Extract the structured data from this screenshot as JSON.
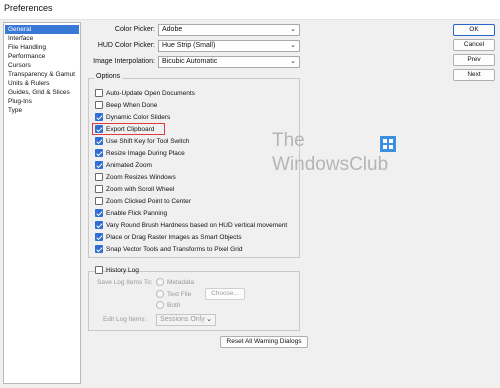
{
  "window": {
    "title": "Preferences"
  },
  "sidebar": {
    "items": [
      {
        "label": "General",
        "selected": true
      },
      {
        "label": "Interface"
      },
      {
        "label": "File Handling"
      },
      {
        "label": "Performance"
      },
      {
        "label": "Cursors"
      },
      {
        "label": "Transparency & Gamut"
      },
      {
        "label": "Units & Rulers"
      },
      {
        "label": "Guides, Grid & Slices"
      },
      {
        "label": "Plug-Ins"
      },
      {
        "label": "Type"
      }
    ]
  },
  "fields": {
    "color_picker": {
      "label": "Color Picker:",
      "value": "Adobe"
    },
    "hud_color_picker": {
      "label": "HUD Color Picker:",
      "value": "Hue Strip (Small)"
    },
    "image_interpolation": {
      "label": "Image Interpolation:",
      "value": "Bicubic Automatic"
    }
  },
  "options": {
    "title": "Options",
    "items": [
      {
        "label": "Auto-Update Open Documents",
        "checked": false
      },
      {
        "label": "Beep When Done",
        "checked": false
      },
      {
        "label": "Dynamic Color Sliders",
        "checked": true
      },
      {
        "label": "Export Clipboard",
        "checked": true,
        "highlighted": true
      },
      {
        "label": "Use Shift Key for Tool Switch",
        "checked": true
      },
      {
        "label": "Resize Image During Place",
        "checked": true
      },
      {
        "label": "Animated Zoom",
        "checked": true
      },
      {
        "label": "Zoom Resizes Windows",
        "checked": false
      },
      {
        "label": "Zoom with Scroll Wheel",
        "checked": false
      },
      {
        "label": "Zoom Clicked Point to Center",
        "checked": false
      },
      {
        "label": "Enable Flick Panning",
        "checked": true
      },
      {
        "label": "Vary Round Brush Hardness based on HUD vertical movement",
        "checked": true
      },
      {
        "label": "Place or Drag Raster Images as Smart Objects",
        "checked": true
      },
      {
        "label": "Snap Vector Tools and Transforms to Pixel Grid",
        "checked": true
      }
    ]
  },
  "history_log": {
    "title": "History Log",
    "checked": false,
    "save_to_label": "Save Log Items To:",
    "radios": [
      "Metadata",
      "Text File",
      "Both"
    ],
    "choose_label": "Choose...",
    "edit_label": "Edit Log Items:",
    "edit_value": "Sessions Only"
  },
  "buttons": {
    "ok": "OK",
    "cancel": "Cancel",
    "prev": "Prev",
    "next": "Next",
    "reset_warnings": "Reset All Warning Dialogs"
  },
  "watermark": {
    "line1": "The",
    "line2": "WindowsClub"
  },
  "colors": {
    "accent": "#2f6fd3",
    "selection": "#3a78d6",
    "highlight_box": "#e23b3b"
  }
}
